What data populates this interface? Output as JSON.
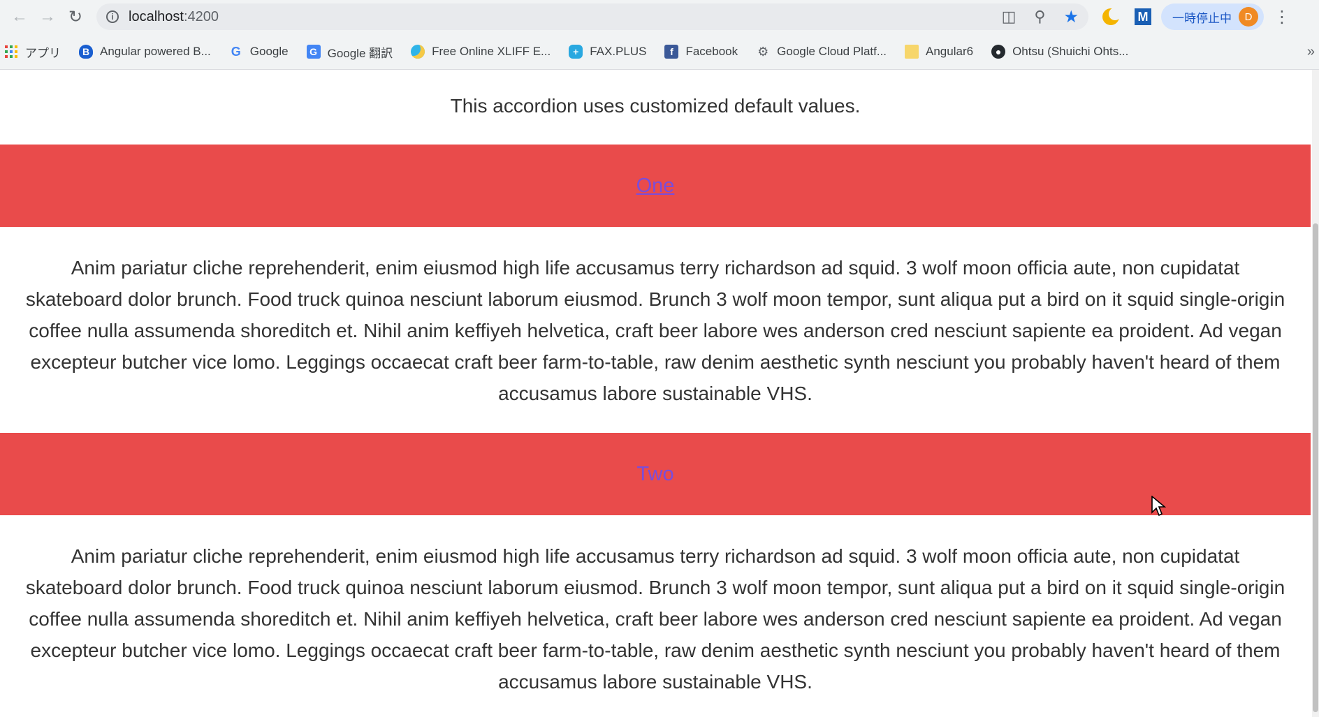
{
  "browser": {
    "url_host": "localhost",
    "url_port": ":4200",
    "pause_label": "一時停止中",
    "avatar_letter": "D",
    "bookmarks": [
      {
        "label": "アプリ"
      },
      {
        "label": "Angular powered B..."
      },
      {
        "label": "Google"
      },
      {
        "label": "Google 翻訳"
      },
      {
        "label": "Free Online XLIFF E..."
      },
      {
        "label": "FAX.PLUS"
      },
      {
        "label": "Facebook"
      },
      {
        "label": "Google Cloud Platf..."
      },
      {
        "label": "Angular6"
      },
      {
        "label": "Ohtsu (Shuichi Ohts..."
      }
    ]
  },
  "page": {
    "intro": "This accordion uses customized default values.",
    "panels": [
      {
        "title": "One",
        "body": "Anim pariatur cliche reprehenderit, enim eiusmod high life accusamus terry richardson ad squid. 3 wolf moon officia aute, non cupidatat skateboard dolor brunch. Food truck quinoa nesciunt laborum eiusmod. Brunch 3 wolf moon tempor, sunt aliqua put a bird on it squid single-origin coffee nulla assumenda shoreditch et. Nihil anim keffiyeh helvetica, craft beer labore wes anderson cred nesciunt sapiente ea proident. Ad vegan excepteur butcher vice lomo. Leggings occaecat craft beer farm-to-table, raw denim aesthetic synth nesciunt you probably haven't heard of them accusamus labore sustainable VHS."
      },
      {
        "title": "Two",
        "body": "Anim pariatur cliche reprehenderit, enim eiusmod high life accusamus terry richardson ad squid. 3 wolf moon officia aute, non cupidatat skateboard dolor brunch. Food truck quinoa nesciunt laborum eiusmod. Brunch 3 wolf moon tempor, sunt aliqua put a bird on it squid single-origin coffee nulla assumenda shoreditch et. Nihil anim keffiyeh helvetica, craft beer labore wes anderson cred nesciunt sapiente ea proident. Ad vegan excepteur butcher vice lomo. Leggings occaecat craft beer farm-to-table, raw denim aesthetic synth nesciunt you probably haven't heard of them accusamus labore sustainable VHS."
      }
    ]
  },
  "colors": {
    "accordion_header": "#e94b4b",
    "link": "#7a4ddb"
  }
}
